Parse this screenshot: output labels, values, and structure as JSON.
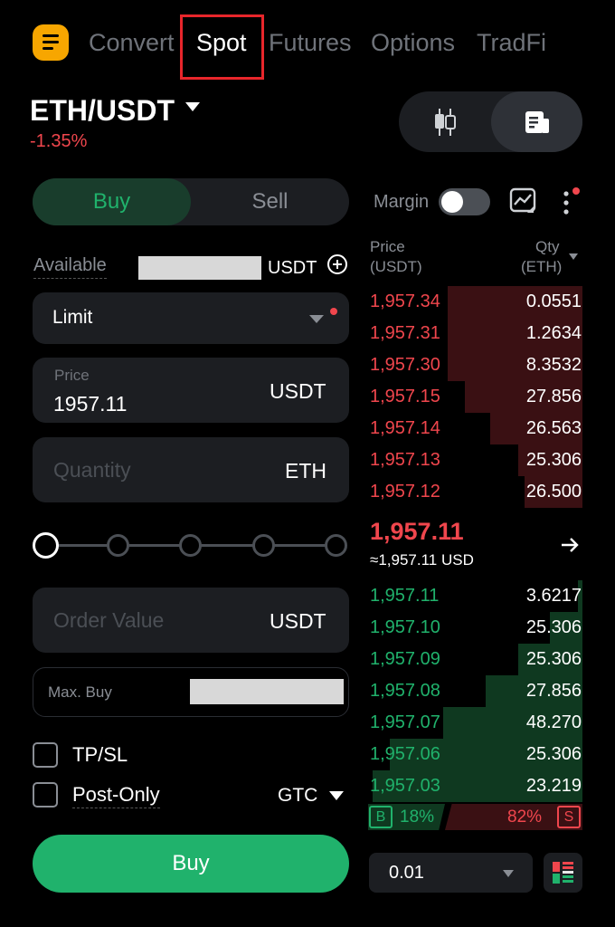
{
  "nav": {
    "tabs": [
      {
        "label": "Convert",
        "active": false
      },
      {
        "label": "Spot",
        "active": true
      },
      {
        "label": "Futures",
        "active": false
      },
      {
        "label": "Options",
        "active": false
      },
      {
        "label": "TradFi",
        "active": false
      }
    ]
  },
  "pair": {
    "symbol": "ETH/USDT",
    "change": "-1.35%"
  },
  "side_toggle": {
    "buy_label": "Buy",
    "sell_label": "Sell",
    "selected": "Buy"
  },
  "available": {
    "label": "Available",
    "unit": "USDT"
  },
  "order_type": {
    "label": "Limit"
  },
  "price": {
    "placeholder": "Price",
    "value": "1957.11",
    "unit": "USDT"
  },
  "quantity": {
    "placeholder": "Quantity",
    "unit": "ETH"
  },
  "slider": {
    "value_percent": 0,
    "stops": [
      0,
      25,
      50,
      75,
      100
    ]
  },
  "order_value": {
    "placeholder": "Order Value",
    "unit": "USDT"
  },
  "max_buy": {
    "label": "Max. Buy"
  },
  "options": {
    "tpsl_label": "TP/SL",
    "post_only_label": "Post-Only",
    "tif": "GTC"
  },
  "submit": {
    "label": "Buy"
  },
  "right_header": {
    "margin_label": "Margin",
    "margin_enabled": false
  },
  "book_header": {
    "price_line1": "Price",
    "price_line2": "(USDT)",
    "qty_line1": "Qty",
    "qty_line2": "(ETH)"
  },
  "asks": [
    {
      "price": "1,957.34",
      "qty": "0.0551",
      "depth": 0.63
    },
    {
      "price": "1,957.31",
      "qty": "1.2634",
      "depth": 0.63
    },
    {
      "price": "1,957.30",
      "qty": "8.3532",
      "depth": 0.63
    },
    {
      "price": "1,957.15",
      "qty": "27.856",
      "depth": 0.55
    },
    {
      "price": "1,957.14",
      "qty": "26.563",
      "depth": 0.43
    },
    {
      "price": "1,957.13",
      "qty": "25.306",
      "depth": 0.3
    },
    {
      "price": "1,957.12",
      "qty": "26.500",
      "depth": 0.27
    }
  ],
  "mid": {
    "price": "1,957.11",
    "usd": "≈1,957.11 USD"
  },
  "bids": [
    {
      "price": "1,957.11",
      "qty": "3.6217",
      "depth": 0.02
    },
    {
      "price": "1,957.10",
      "qty": "25.306",
      "depth": 0.15
    },
    {
      "price": "1,957.09",
      "qty": "25.306",
      "depth": 0.3
    },
    {
      "price": "1,957.08",
      "qty": "27.856",
      "depth": 0.45
    },
    {
      "price": "1,957.07",
      "qty": "48.270",
      "depth": 0.65
    },
    {
      "price": "1,957.06",
      "qty": "25.306",
      "depth": 0.9
    },
    {
      "price": "1,957.03",
      "qty": "23.219",
      "depth": 0.98
    }
  ],
  "ratio": {
    "buy_tag": "B",
    "buy_pct": "18%",
    "sell_pct": "82%",
    "sell_tag": "S"
  },
  "precision": {
    "value": "0.01"
  },
  "colors": {
    "accent_green": "#20b26c",
    "accent_red": "#f0464d",
    "brand_orange": "#f7a600"
  },
  "icons": [
    "menu-icon",
    "candlestick-icon",
    "orderbook-icon",
    "chart-icon",
    "more-icon",
    "add-circle-icon",
    "arrow-right-icon",
    "layout-icon"
  ]
}
